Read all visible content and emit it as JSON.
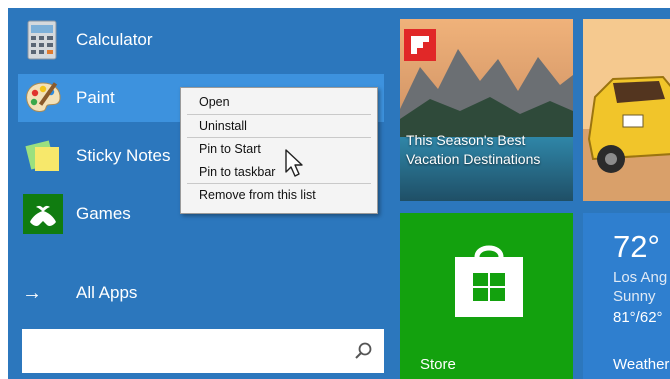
{
  "apps": [
    {
      "label": "Calculator",
      "icon": "calculator-icon"
    },
    {
      "label": "Paint",
      "icon": "paint-palette-icon"
    },
    {
      "label": "Sticky Notes",
      "icon": "sticky-notes-icon"
    },
    {
      "label": "Games",
      "icon": "xbox-games-icon"
    }
  ],
  "all_apps": {
    "label": "All Apps",
    "icon": "arrow-right-icon"
  },
  "search": {
    "value": "",
    "placeholder": "",
    "icon": "search-icon"
  },
  "context_menu": {
    "items": [
      "Open",
      "Uninstall",
      "Pin to Start",
      "Pin to taskbar",
      "Remove from this list"
    ]
  },
  "tiles": {
    "news": {
      "title": "This Season's Best Vacation Destinations",
      "app_icon": "flipboard-icon"
    },
    "store": {
      "label": "Store",
      "icon": "store-bag-icon"
    },
    "weather": {
      "temp": "72°",
      "city": "Los Ang",
      "condition": "Sunny",
      "range": "81°/62°",
      "label": "Weather"
    }
  },
  "colors": {
    "start_bg": "#2c77bd",
    "selected_row": "#3d92de",
    "store_tile": "#13a10e",
    "weather_tile": "#2f7fcf"
  }
}
